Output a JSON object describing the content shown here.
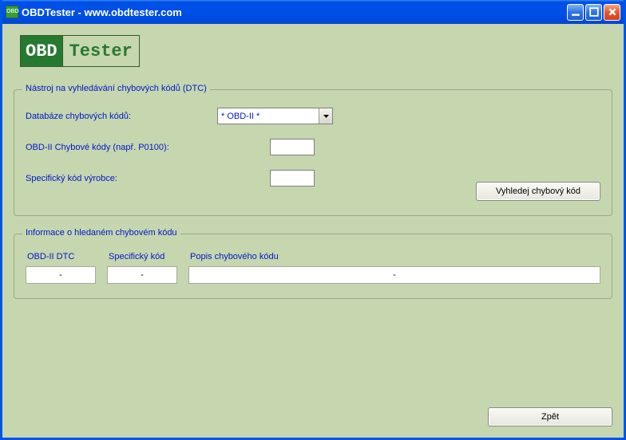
{
  "window": {
    "title": "OBDTester - www.obdtester.com"
  },
  "logo": {
    "left": "OBD",
    "right": "Tester"
  },
  "group1": {
    "legend": "Nástroj na vyhledávání chybových kódů (DTC)",
    "label_db": "Databáze chybových kódů:",
    "combo_value": "* OBD-II *",
    "label_obd2": "OBD-II Chybové kódy (např. P0100):",
    "input_obd2": "",
    "label_spec": "Specifický kód výrobce:",
    "input_spec": "",
    "btn_lookup": "Vyhledej chybový kód"
  },
  "group2": {
    "legend": "Informace o hledaném chybovém kódu",
    "col_dtc_label": "OBD-II DTC",
    "col_dtc_val": "-",
    "col_spec_label": "Specifický kód",
    "col_spec_val": "-",
    "col_desc_label": "Popis chybového kódu",
    "col_desc_val": "-"
  },
  "btn_back": "Zpět"
}
